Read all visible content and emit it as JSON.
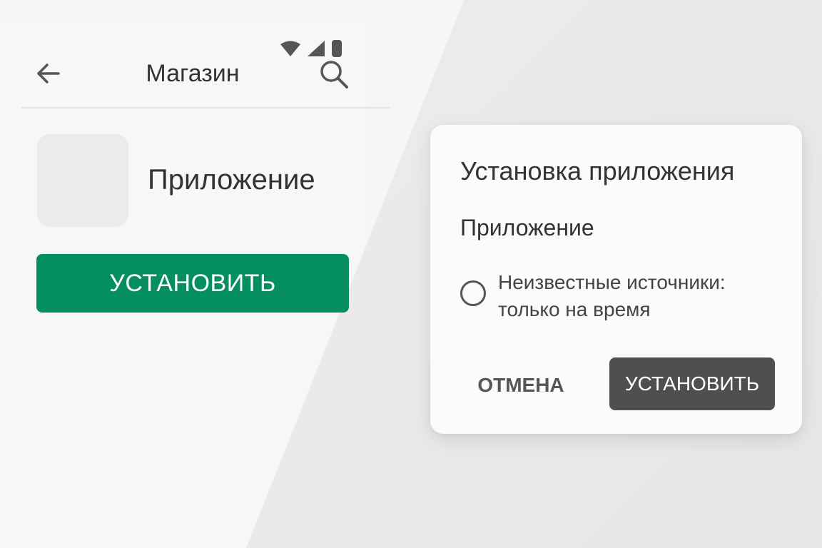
{
  "store": {
    "title": "Магазин",
    "back_icon": "arrow-back-icon",
    "search_icon": "search-icon",
    "app_name": "Приложение",
    "install_label": "УСТАНОВИТЬ",
    "install_color": "#068f5e"
  },
  "status_bar": {
    "icons": [
      "wifi-icon",
      "cellular-signal-icon",
      "battery-icon"
    ]
  },
  "dialog": {
    "title": "Установка приложения",
    "app_name": "Приложение",
    "option_label": "Неизвестные источники: только на время",
    "option_selected": false,
    "cancel_label": "ОТМЕНА",
    "confirm_label": "УСТАНОВИТЬ",
    "confirm_color": "#4f4f4f"
  }
}
